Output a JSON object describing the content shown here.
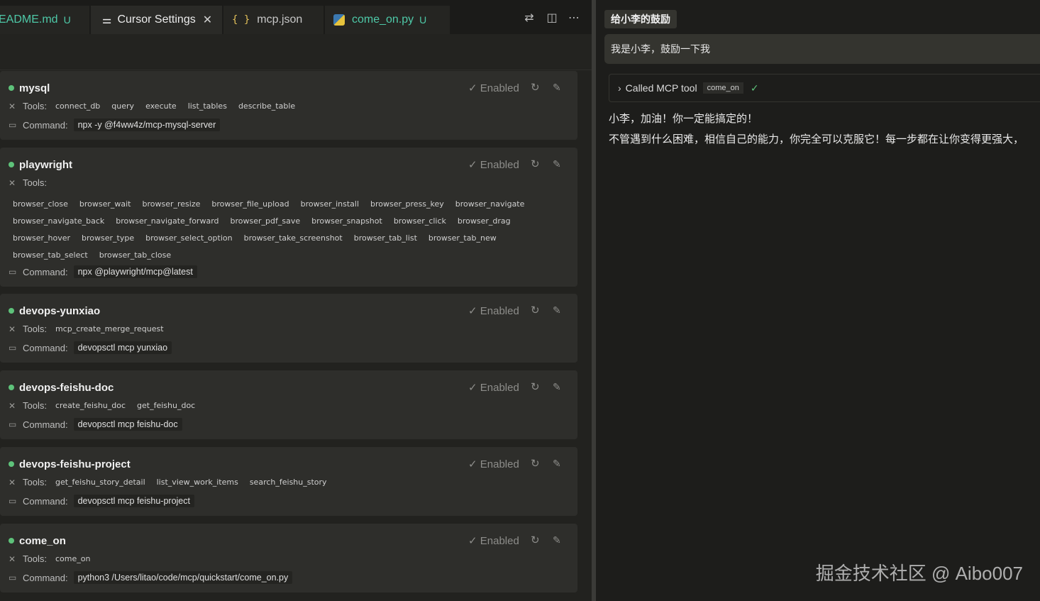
{
  "tabs": [
    {
      "label": "EADME.md",
      "badge": "U"
    },
    {
      "label": "Cursor Settings",
      "icon": "settings-sliders-icon"
    },
    {
      "label": "mcp.json",
      "icon": "braces-icon"
    },
    {
      "label": "come_on.py",
      "badge": "U",
      "icon": "python-icon"
    }
  ],
  "labels": {
    "tools": "Tools:",
    "command": "Command:",
    "enabled": "Enabled"
  },
  "servers": [
    {
      "name": "mysql",
      "tools": [
        "connect_db",
        "query",
        "execute",
        "list_tables",
        "describe_table"
      ],
      "command": "npx -y @f4ww4z/mcp-mysql-server"
    },
    {
      "name": "playwright",
      "tools": [
        "browser_close",
        "browser_wait",
        "browser_resize",
        "browser_file_upload",
        "browser_install",
        "browser_press_key",
        "browser_navigate",
        "browser_navigate_back",
        "browser_navigate_forward",
        "browser_pdf_save",
        "browser_snapshot",
        "browser_click",
        "browser_drag",
        "browser_hover",
        "browser_type",
        "browser_select_option",
        "browser_take_screenshot",
        "browser_tab_list",
        "browser_tab_new",
        "browser_tab_select",
        "browser_tab_close"
      ],
      "command": "npx @playwright/mcp@latest"
    },
    {
      "name": "devops-yunxiao",
      "tools": [
        "mcp_create_merge_request"
      ],
      "command": "devopsctl mcp yunxiao"
    },
    {
      "name": "devops-feishu-doc",
      "tools": [
        "create_feishu_doc",
        "get_feishu_doc"
      ],
      "command": "devopsctl mcp feishu-doc"
    },
    {
      "name": "devops-feishu-project",
      "tools": [
        "get_feishu_story_detail",
        "list_view_work_items",
        "search_feishu_story"
      ],
      "command": "devopsctl mcp feishu-project"
    },
    {
      "name": "come_on",
      "tools": [
        "come_on"
      ],
      "command": "python3 /Users/litao/code/mcp/quickstart/come_on.py"
    }
  ],
  "chat": {
    "title": "给小李的鼓励",
    "user_message": "我是小李，鼓励一下我",
    "tool_call_label": "Called MCP tool",
    "tool_name": "come_on",
    "reply_lines": [
      "小李，加油！你一定能搞定的！",
      "不管遇到什么困难，相信自己的能力，你完全可以克服它！每一步都在让你变得更强大，"
    ]
  },
  "watermark": "掘金技术社区 @ Aibo007",
  "colors": {
    "accent_green": "#5ec27a",
    "untracked": "#4ec9a8"
  }
}
